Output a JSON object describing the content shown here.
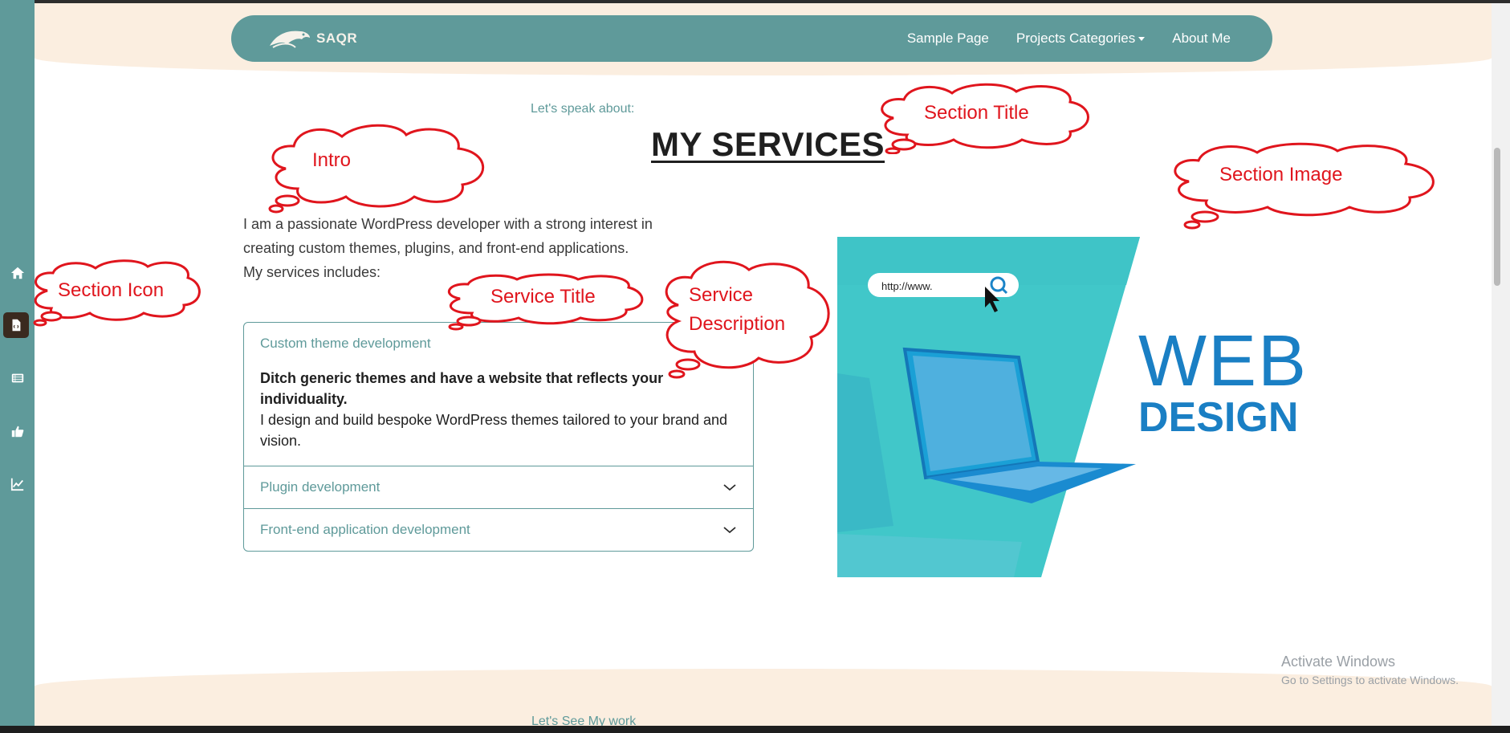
{
  "sidebar": {
    "items": [
      {
        "icon": "home-icon"
      },
      {
        "icon": "document-icon",
        "active": true
      },
      {
        "icon": "list-icon"
      },
      {
        "icon": "thumbs-up-icon"
      },
      {
        "icon": "chart-icon"
      }
    ]
  },
  "navbar": {
    "logo_text": "SAQR",
    "links": [
      "Sample Page",
      "Projects Categories",
      "About Me"
    ]
  },
  "section": {
    "eyebrow": "Let's speak about:",
    "title": "MY SERVICES",
    "intro_lines": [
      "I am a passionate WordPress developer with a strong interest in",
      "creating custom themes, plugins, and front-end applications.",
      "My services includes:"
    ]
  },
  "services": [
    {
      "title": "Custom theme development",
      "expanded": true,
      "desc_bold": "Ditch generic themes and have a website that reflects your individuality.",
      "desc_text": "I design and build bespoke WordPress themes tailored to your brand and vision."
    },
    {
      "title": "Plugin development",
      "expanded": false
    },
    {
      "title": "Front-end application development",
      "expanded": false
    }
  ],
  "image": {
    "url_text": "http://www.",
    "word1": "WEB",
    "word2": "DESIGN"
  },
  "annotations": [
    "Intro",
    "Section Title",
    "Section Image",
    "Section Icon",
    "Service Title",
    "Service",
    "Description"
  ],
  "next_section": {
    "eyebrow": "Let's See My work"
  },
  "watermark": {
    "line1": "Activate Windows",
    "line2": "Go to Settings to activate Windows."
  },
  "colors": {
    "teal": "#5f9a9a",
    "beige": "#fbeee0",
    "annotation_red": "#e0151d",
    "brown_active": "#3a2a1f"
  }
}
